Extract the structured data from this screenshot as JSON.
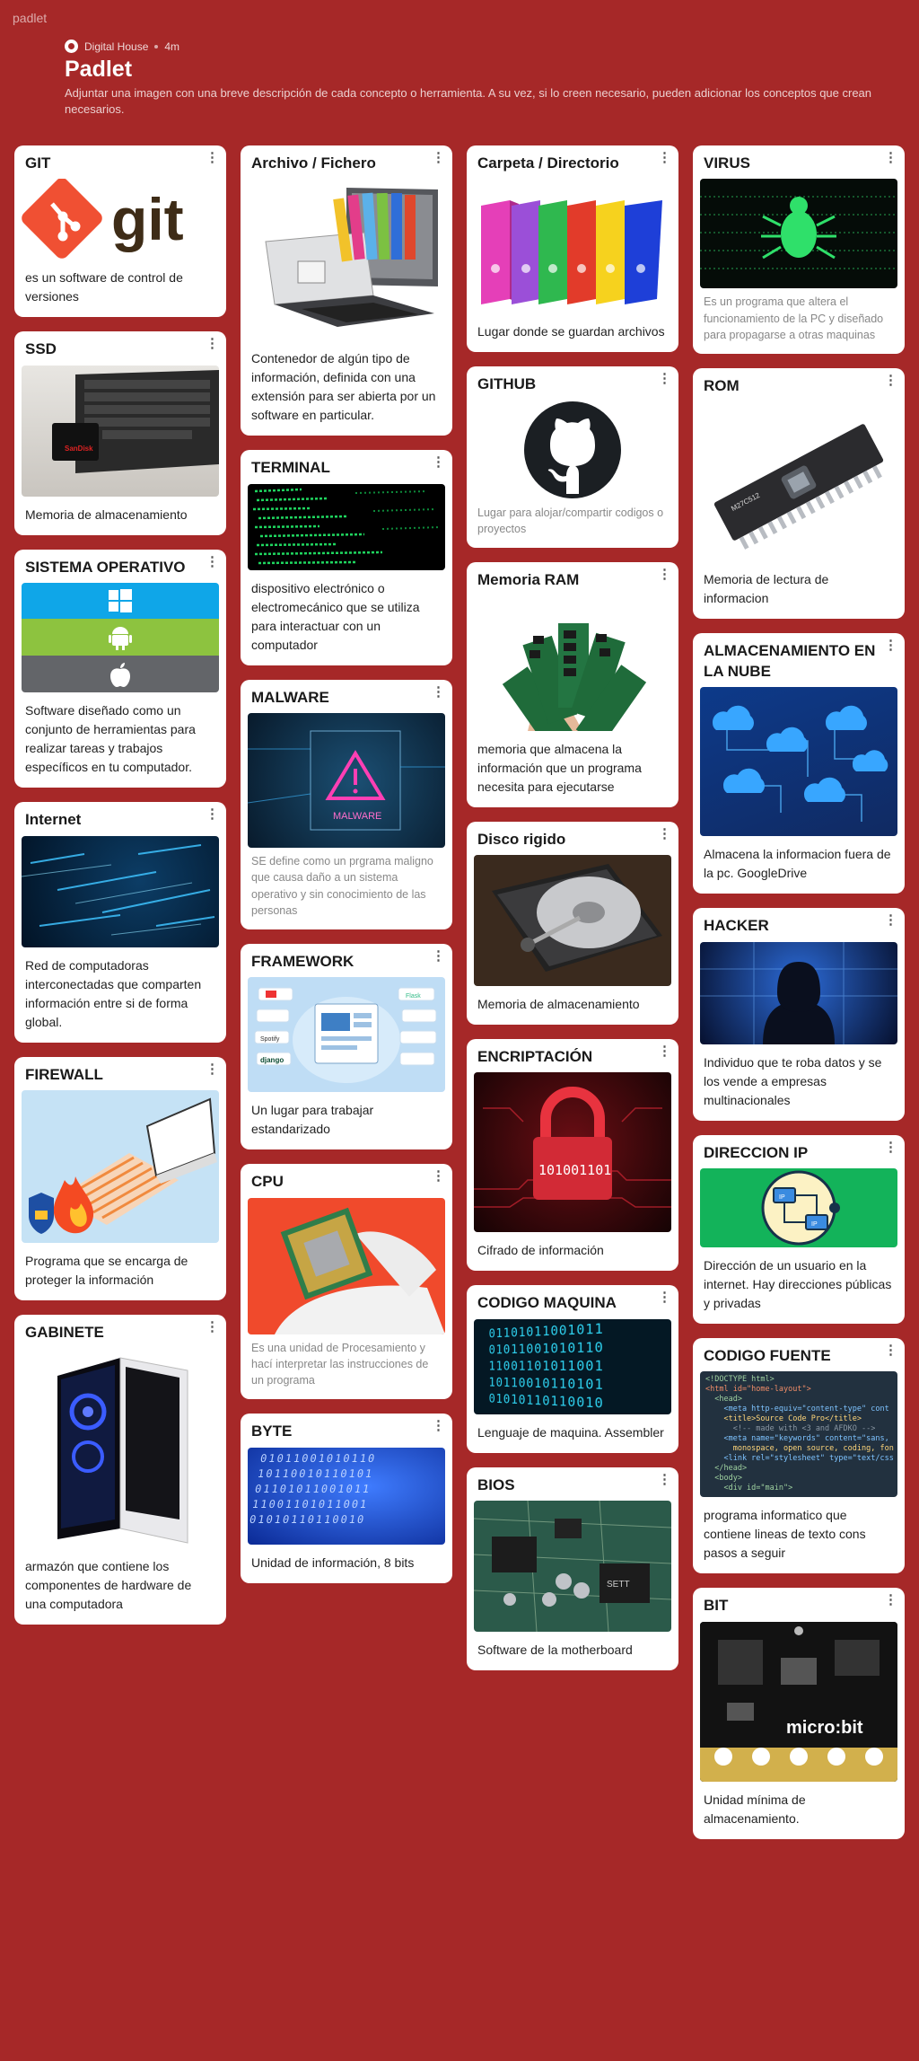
{
  "app": {
    "brand": "padlet",
    "author": "Digital House",
    "age": "4m",
    "title": "Padlet",
    "description": "Adjuntar una imagen con una breve descripción de cada concepto o herramienta. A su vez, si lo creen necesario, pueden adicionar los conceptos que crean necesarios."
  },
  "img": {
    "git": "git",
    "framework_brands": [
      "django",
      "Spotify",
      "Flask"
    ],
    "ip_tags": [
      "IP",
      "IP"
    ],
    "bios_board": "SETT",
    "encryption_digits": "101001101",
    "binary_rows": [
      "01011001010110",
      "10110010110101",
      "01101011001011",
      "11001101011001",
      "01010110110010"
    ],
    "code_lines": [
      "<!DOCTYPE html>",
      "<html id=\"home-layout\">",
      "  <head>",
      "    <meta http-equiv=\"content-type\" cont",
      "    <title>Source Code Pro</title>",
      "      <!-- made with <3 and AFDKO -->",
      "    <meta name=\"keywords\" content=\"sans,",
      "      monospace, open source, coding, fon",
      "    <link rel=\"stylesheet\" type=\"text/css",
      "  </head>",
      "  <body>",
      "    <div id=\"main\">"
    ],
    "microbit": "micro:bit",
    "rom_chip": "M27C512",
    "malware": "MALWARE"
  },
  "cards": [
    {
      "title": "GIT",
      "text": "es un software de control de versiones"
    },
    {
      "title": "SSD",
      "text": "Memoria de almacenamiento"
    },
    {
      "title": "SISTEMA OPERATIVO",
      "text": "Software diseñado como un conjunto de herramientas para realizar tareas y trabajos específicos en tu computador."
    },
    {
      "title": "Internet",
      "text": "Red de computadoras interconectadas que comparten información entre si de forma global."
    },
    {
      "title": "FIREWALL",
      "text": "Programa que se encarga de proteger la información"
    },
    {
      "title": "GABINETE",
      "text": "armazón que contiene los componentes de hardware de una computadora"
    },
    {
      "title": "Archivo / Fichero",
      "text": "Contenedor de algún tipo de información, definida con una extensión para ser abierta por un software en particular."
    },
    {
      "title": "TERMINAL",
      "text": "dispositivo electrónico o electromecánico que se utiliza para interactuar con un computador"
    },
    {
      "title": "MALWARE",
      "text": "SE define como un prgrama maligno que causa daño a un sistema operativo y sin conocimiento de las personas"
    },
    {
      "title": "FRAMEWORK",
      "text": "Un lugar para trabajar estandarizado"
    },
    {
      "title": "CPU",
      "text": "Es una unidad de Procesamiento y hací interpretar las instrucciones de un programa"
    },
    {
      "title": "BYTE",
      "text": "Unidad de información, 8 bits"
    },
    {
      "title": "Carpeta / Directorio",
      "text": "Lugar donde se guardan archivos"
    },
    {
      "title": "GITHUB",
      "text": "Lugar para alojar/compartir codigos o proyectos"
    },
    {
      "title": "Memoria RAM",
      "text": "memoria que almacena la información que un programa necesita para ejecutarse"
    },
    {
      "title": "Disco rigido",
      "text": "Memoria de almacenamiento"
    },
    {
      "title": "ENCRIPTACIÓN",
      "text": "Cifrado de información"
    },
    {
      "title": "CODIGO MAQUINA",
      "text": "Lenguaje de maquina. Assembler"
    },
    {
      "title": "BIOS",
      "text": "Software de la motherboard"
    },
    {
      "title": "VIRUS",
      "text": "Es un programa que altera el funcionamiento de la PC y diseñado para propagarse a otras maquinas"
    },
    {
      "title": "ROM",
      "text": "Memoria de lectura de informacion"
    },
    {
      "title": "ALMACENAMIENTO EN LA NUBE",
      "text": "Almacena la informacion fuera de la pc. GoogleDrive"
    },
    {
      "title": "HACKER",
      "text": "Individuo que te roba datos y se los vende a empresas multinacionales"
    },
    {
      "title": "DIRECCION IP",
      "text": "Dirección de un usuario en la internet. Hay direcciones públicas y privadas"
    },
    {
      "title": "CODIGO FUENTE",
      "text": "programa informatico que contiene lineas de texto cons pasos a seguir"
    },
    {
      "title": "BIT",
      "text": "Unidad mínima de almacenamiento."
    }
  ]
}
